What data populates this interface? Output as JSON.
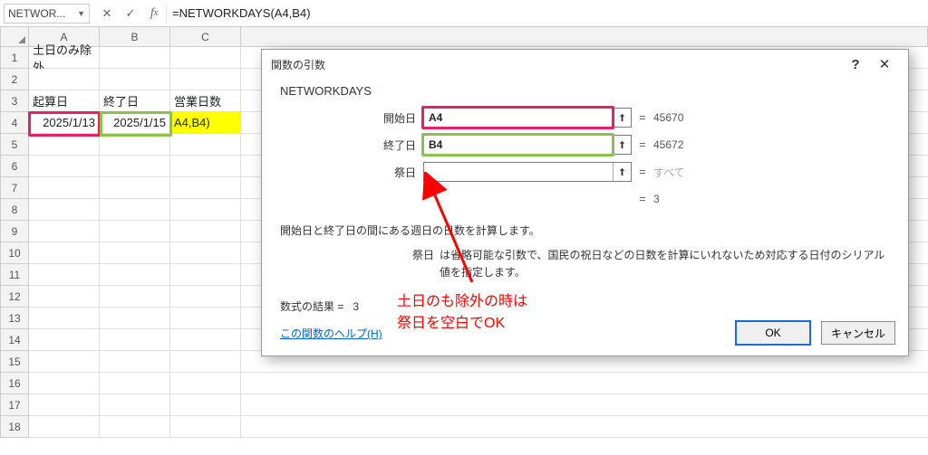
{
  "formula_bar": {
    "name_box": "NETWOR...",
    "formula": "=NETWORKDAYS(A4,B4)"
  },
  "columns": [
    "A",
    "B",
    "C"
  ],
  "rows": [
    "1",
    "2",
    "3",
    "4",
    "5",
    "6",
    "7",
    "8",
    "9",
    "10",
    "11",
    "12",
    "13",
    "14",
    "15",
    "16",
    "17",
    "18"
  ],
  "cells": {
    "A1": "土日のみ除外",
    "A3": "起算日",
    "B3": "終了日",
    "C3": "営業日数",
    "A4": "2025/1/13",
    "B4": "2025/1/15",
    "C4": "A4,B4)"
  },
  "dialog": {
    "title": "関数の引数",
    "func": "NETWORKDAYS",
    "args": [
      {
        "label": "開始日",
        "value": "A4",
        "result": "45670",
        "hl": "#e91e63"
      },
      {
        "label": "終了日",
        "value": "B4",
        "result": "45672",
        "hl": "#8bc34a"
      },
      {
        "label": "祭日",
        "value": "",
        "result": "すべて",
        "dim": true,
        "cursor": true
      }
    ],
    "calc_eq": "=",
    "calc_val": "3",
    "desc1": "開始日と終了日の間にある週日の日数を計算します。",
    "desc2_label": "祭日",
    "desc2_text": "は省略可能な引数で、国民の祝日などの日数を計算にいれないため対応する日付のシリアル値を指定します。",
    "result_label": "数式の結果 =",
    "result_value": "3",
    "help": "この関数のヘルプ(H)",
    "ok": "OK",
    "cancel": "キャンセル"
  },
  "annotation": {
    "line1": "土日のも除外の時は",
    "line2": "祭日を空白でOK"
  }
}
